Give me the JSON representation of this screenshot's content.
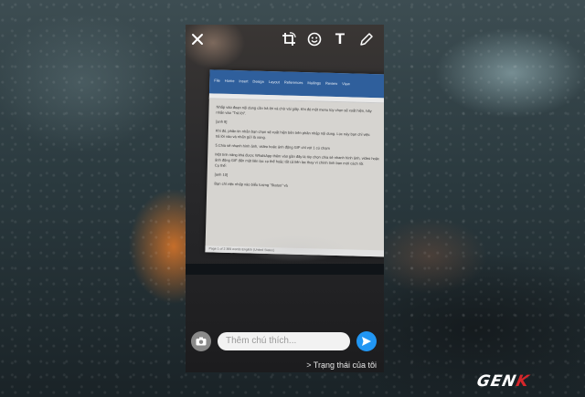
{
  "top_bar": {
    "icons": [
      "close-icon",
      "crop-rotate-icon",
      "emoji-icon",
      "text-icon",
      "pencil-icon"
    ],
    "text_tool_label": "T"
  },
  "photo": {
    "document_tabs": [
      "File",
      "Home",
      "Insert",
      "Design",
      "Layout",
      "References",
      "Mailings",
      "Review",
      "View"
    ],
    "document_lines": [
      "Nhấp vào đoạn nội dung cần trả lời và chờ vài giây. Khi đó một menu tùy chọn sẽ xuất hiện, hãy",
      "nhấn vào \"Trả lời\".",
      "[anh 9]",
      "Khi đó, phần tin nhắn bạn chọn sẽ xuất hiện bên trên phần nhập nội dung. Lúc này bạn chỉ việc",
      "trả lời vào và nhấn gửi là xong.",
      "5.Chia sẻ nhanh hình ảnh, video hoặc ảnh động GIF chỉ với 1 cú chạm",
      "Một tính năng khá được WhatsApp thêm vào gần đây là tùy chọn chia sẻ nhanh hình ảnh, video hoặc",
      "ảnh động GIF đến một liên lạc cụ thể hoặc tất cả liên lạc thay vì chính tình bạn mới cách rồi.",
      "Cụ thể:",
      "[anh 10]",
      "Bạn chỉ việc nhấp vào biểu tượng \"Status\" và",
      "Page 1 of 2    369 words    English (United States)"
    ]
  },
  "caption": {
    "placeholder": "Thêm chú thích...",
    "camera_icon": "camera-icon",
    "send_icon": "send-icon"
  },
  "status_link": "> Trạng thái của tôi",
  "watermark": {
    "text_main": "GEN",
    "text_accent": "K"
  },
  "colors": {
    "send_button": "#2196f3",
    "logo_accent": "#d6262b"
  }
}
